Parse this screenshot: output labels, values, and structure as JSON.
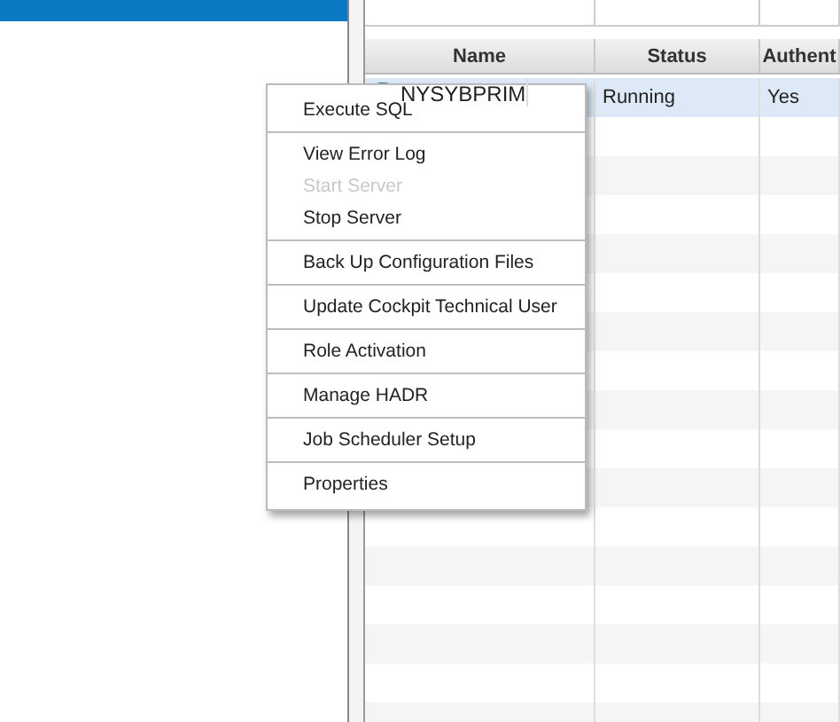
{
  "table": {
    "columns": [
      "Name",
      "Status",
      "Authent"
    ],
    "rows": [
      {
        "name": "NYSYBPRIM",
        "status": "Running",
        "column_3": "Yes",
        "selected": true
      }
    ]
  },
  "context_menu": {
    "groups": [
      [
        {
          "label": "Execute SQL",
          "disabled": false
        }
      ],
      [
        {
          "label": "View Error Log",
          "disabled": false
        },
        {
          "label": "Start Server",
          "disabled": true
        },
        {
          "label": "Stop Server",
          "disabled": false
        }
      ],
      [
        {
          "label": "Back Up Configuration Files",
          "disabled": false
        }
      ],
      [
        {
          "label": "Update Cockpit Technical User",
          "disabled": false
        }
      ],
      [
        {
          "label": "Role Activation",
          "disabled": false
        }
      ],
      [
        {
          "label": "Manage HADR",
          "disabled": false
        }
      ],
      [
        {
          "label": "Job Scheduler Setup",
          "disabled": false
        }
      ],
      [
        {
          "label": "Properties",
          "disabled": false
        }
      ]
    ]
  }
}
